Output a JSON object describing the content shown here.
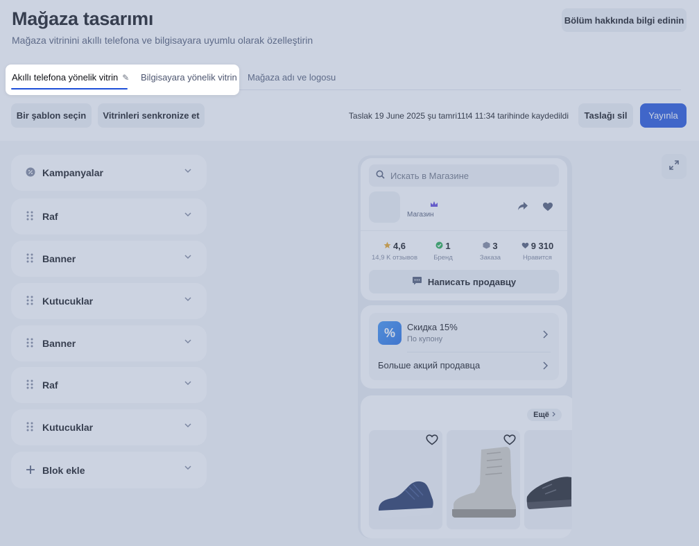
{
  "header": {
    "title": "Mağaza tasarımı",
    "subtitle": "Mağaza vitrinini akıllı telefona ve bilgisayara uyumlu olarak özelleştirin",
    "help_button": "Bölüm hakkında bilgi edinin"
  },
  "tabs": [
    {
      "label": "Akıllı telefona yönelik vitrin",
      "active": true,
      "icon": "pencil-icon"
    },
    {
      "label": "Bilgisayara yönelik vitrin",
      "active": false
    },
    {
      "label": "Mağaza adı ve logosu",
      "active": false
    }
  ],
  "toolbar": {
    "template_button": "Bir şablon seçin",
    "sync_button": "Vitrinleri senkronize et",
    "draft_status": "Taslak 19 June 2025 şu tamri11t4 11:34 tarihinde kaydedildi",
    "delete_button": "Taslağı sil",
    "publish_button": "Yayınla"
  },
  "blocks": [
    {
      "label": "Kampanyalar",
      "icon": "badge-icon"
    },
    {
      "label": "Raf",
      "icon": "drag-handle-icon"
    },
    {
      "label": "Banner",
      "icon": "drag-handle-icon"
    },
    {
      "label": "Kutucuklar",
      "icon": "drag-handle-icon"
    },
    {
      "label": "Banner",
      "icon": "drag-handle-icon"
    },
    {
      "label": "Raf",
      "icon": "drag-handle-icon"
    },
    {
      "label": "Kutucuklar",
      "icon": "drag-handle-icon"
    },
    {
      "label": "Blok ekle",
      "icon": "plus-icon"
    }
  ],
  "preview": {
    "search_placeholder": "Искать в Магазине",
    "store_label": "Магазин",
    "stats": [
      {
        "value": "4,6",
        "label": "14,9 K отзывов",
        "icon": "star-icon"
      },
      {
        "value": "1",
        "label": "Бренд",
        "icon": "check-icon"
      },
      {
        "value": "3",
        "label": "Заказа",
        "icon": "box-icon"
      },
      {
        "value": "9 310",
        "label": "Нравится",
        "icon": "heart-icon"
      }
    ],
    "message_button": "Написать продавцу",
    "promo": {
      "badge": "%",
      "title": "Скидка 15%",
      "subtitle": "По купону",
      "more": "Больше акций продавца"
    },
    "products_more": "Ещё"
  },
  "colors": {
    "accent": "#1d4fd8",
    "overlay": "rgba(120,140,175,0.38)"
  }
}
